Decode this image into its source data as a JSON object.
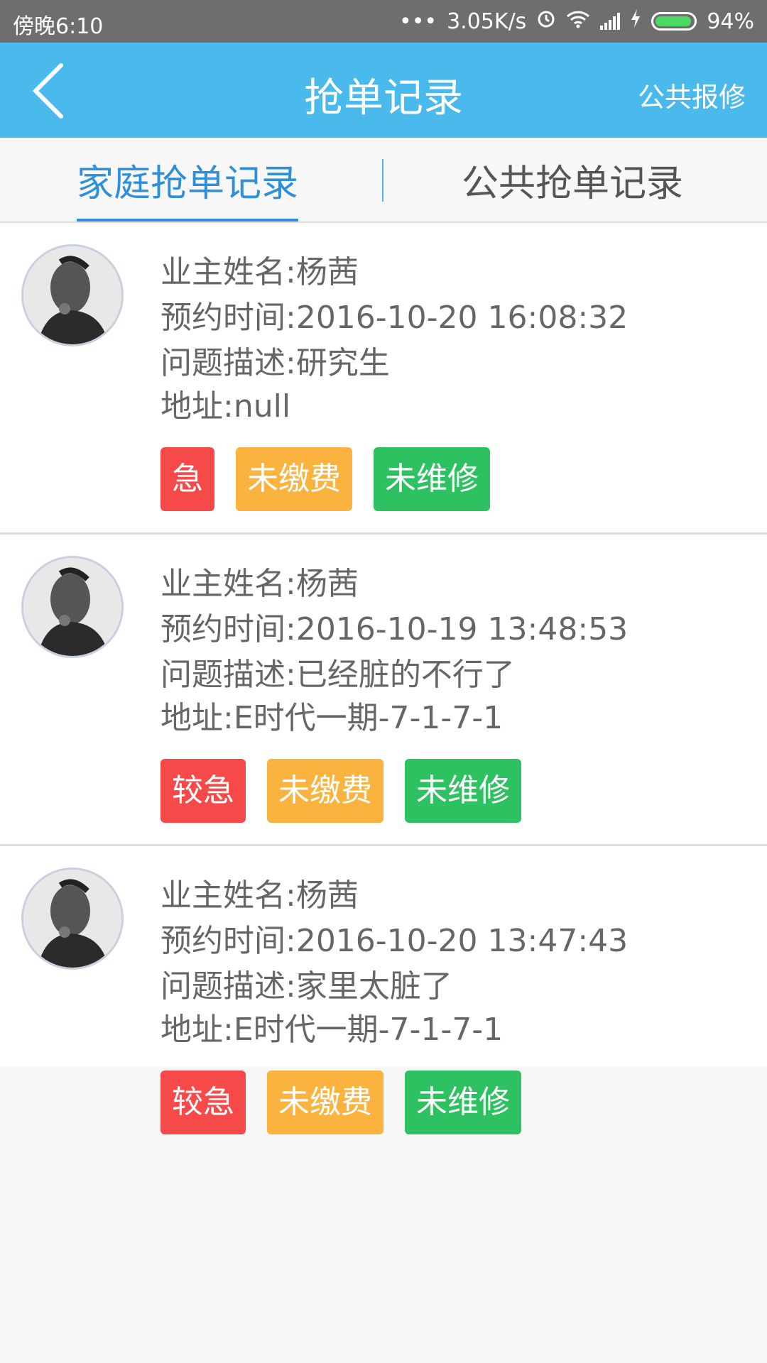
{
  "status_bar": {
    "time": "傍晚6:10",
    "net_speed": "3.05K/s",
    "battery": "94%",
    "icons": [
      "dots-icon",
      "alarm-icon",
      "wifi-icon",
      "signal-icon",
      "charging-icon",
      "battery-icon"
    ]
  },
  "header": {
    "title": "抢单记录",
    "right_action": "公共报修",
    "back_icon": "chevron-left-icon"
  },
  "tabs": {
    "family": "家庭抢单记录",
    "public": "公共抢单记录",
    "active": "family"
  },
  "colors": {
    "header": "#4ab9ec",
    "accent": "#2f8fd8",
    "urgent": "#f64a4a",
    "unpaid": "#fbb33f",
    "unrepaired": "#2ec162"
  },
  "records": [
    {
      "owner": "业主姓名:杨茜",
      "time": "预约时间:2016-10-20 16:08:32",
      "desc": "问题描述:研究生",
      "address": "地址:null",
      "tags": [
        "急",
        "未缴费",
        "未维修"
      ]
    },
    {
      "owner": "业主姓名:杨茜",
      "time": "预约时间:2016-10-19 13:48:53",
      "desc": "问题描述:已经脏的不行了",
      "address": "地址:E时代一期-7-1-7-1",
      "tags": [
        "较急",
        "未缴费",
        "未维修"
      ]
    },
    {
      "owner": "业主姓名:杨茜",
      "time": "预约时间:2016-10-20 13:47:43",
      "desc": "问题描述:家里太脏了",
      "address": "地址:E时代一期-7-1-7-1",
      "tags": [
        "较急",
        "未缴费",
        "未维修"
      ]
    }
  ]
}
